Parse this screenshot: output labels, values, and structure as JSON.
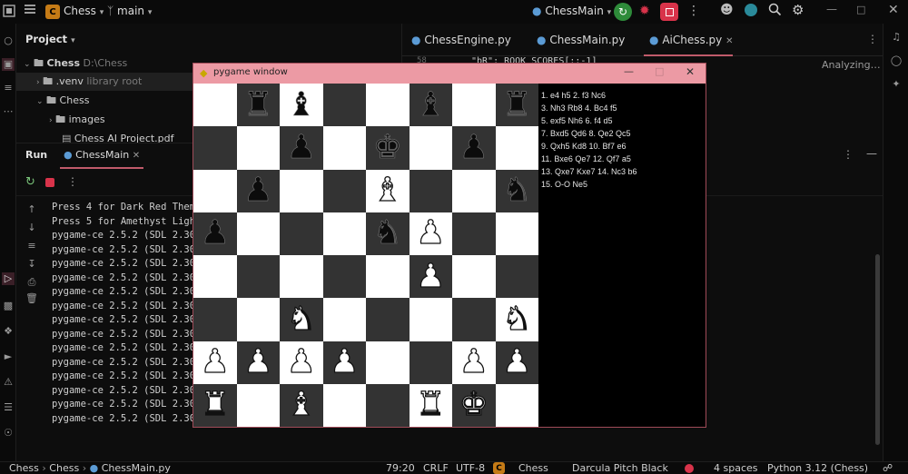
{
  "topbar": {
    "project_badge": "C",
    "project_name": "Chess",
    "branch": "main",
    "run_config": "ChessMain"
  },
  "project_panel": {
    "title": "Project",
    "root": {
      "name": "Chess",
      "path": "D:\\Chess"
    },
    "items": [
      {
        "name": ".venv",
        "note": "library root"
      },
      {
        "name": "Chess",
        "note": ""
      },
      {
        "name": "images",
        "note": ""
      },
      {
        "name": "Chess AI Project.pdf",
        "note": ""
      }
    ]
  },
  "editor": {
    "tabs": [
      {
        "label": "ChessEngine.py"
      },
      {
        "label": "ChessMain.py"
      },
      {
        "label": "AiChess.py"
      }
    ],
    "line_number": "58",
    "code_line": "\"bR\": ROOK_SCORES[::-1]",
    "status": "Analyzing…"
  },
  "run_panel": {
    "title": "Run",
    "tab": "ChessMain",
    "console_lines": [
      "Press 4 for Dark Red Theme",
      "Press 5 for Amethyst Light Theme",
      "pygame-ce 2.5.2 (SDL 2.30.8, Python 3.12.2)",
      "pygame-ce 2.5.2 (SDL 2.30.8, Python 3.12.2)",
      "pygame-ce 2.5.2 (SDL 2.30.8, Python 3.12.2)",
      "pygame-ce 2.5.2 (SDL 2.30.8, Python 3.12.2)",
      "pygame-ce 2.5.2 (SDL 2.30.8, Python 3.12.2)",
      "pygame-ce 2.5.2 (SDL 2.30.8, Python 3.12.2)",
      "pygame-ce 2.5.2 (SDL 2.30.8, Python 3.12.2)",
      "pygame-ce 2.5.2 (SDL 2.30.8, Python 3.12.2)",
      "pygame-ce 2.5.2 (SDL 2.30.8, Python 3.12.2)",
      "pygame-ce 2.5.2 (SDL 2.30.8, Python 3.12.2)",
      "pygame-ce 2.5.2 (SDL 2.30.8, Python 3.12.2)",
      "pygame-ce 2.5.2 (SDL 2.30.8, Python 3.12.2)",
      "pygame-ce 2.5.2 (SDL 2.30.8, Python 3.12.2)",
      "pygame-ce 2.5.2 (SDL 2.30.8, Python 3.12.2)"
    ]
  },
  "pygame": {
    "title": "pygame window",
    "board": [
      [
        "",
        "bR",
        "bB",
        "",
        "",
        "bB",
        "",
        "bR"
      ],
      [
        "",
        "",
        "bp",
        "",
        "bK",
        "",
        "bp",
        ""
      ],
      [
        "",
        "bp",
        "",
        "",
        "wB",
        "",
        "",
        "bN"
      ],
      [
        "bp",
        "",
        "",
        "",
        "bN",
        "wp",
        "",
        ""
      ],
      [
        "",
        "",
        "",
        "",
        "",
        "wp",
        "",
        ""
      ],
      [
        "",
        "",
        "wN",
        "",
        "",
        "",
        "",
        "wN"
      ],
      [
        "wp",
        "wp",
        "wp",
        "wp",
        "",
        "",
        "wp",
        "wp"
      ],
      [
        "wR",
        "",
        "wB",
        "",
        "",
        "wR",
        "wK",
        ""
      ]
    ],
    "moves": [
      "1. e4 h5  2. f3 Nc6",
      "3. Nh3 Rb8  4. Bc4 f5",
      "5. exf5 Nh6  6. f4 d5",
      "7. Bxd5 Qd6  8. Qe2 Qc5",
      "9. Qxh5 Kd8  10. Bf7 e6",
      "11. Bxe6 Qe7  12. Qf7 a5",
      "13. Qxe7 Kxe7  14. Nc3 b6",
      "15. O-O Ne5"
    ]
  },
  "statusbar": {
    "crumbs": [
      "Chess",
      "Chess",
      "ChessMain.py"
    ],
    "position": "79:20",
    "line_sep": "CRLF",
    "encoding": "UTF-8",
    "badge": "C",
    "project": "Chess",
    "theme": "Darcula Pitch Black",
    "indent": "4 spaces",
    "interpreter": "Python 3.12 (Chess)"
  },
  "colors": {
    "accent_green": "#2e8b3a",
    "accent_red": "#d8334a",
    "window_title": "#ec9aa4",
    "board_dark": "#333333",
    "board_light": "#ffffff"
  }
}
